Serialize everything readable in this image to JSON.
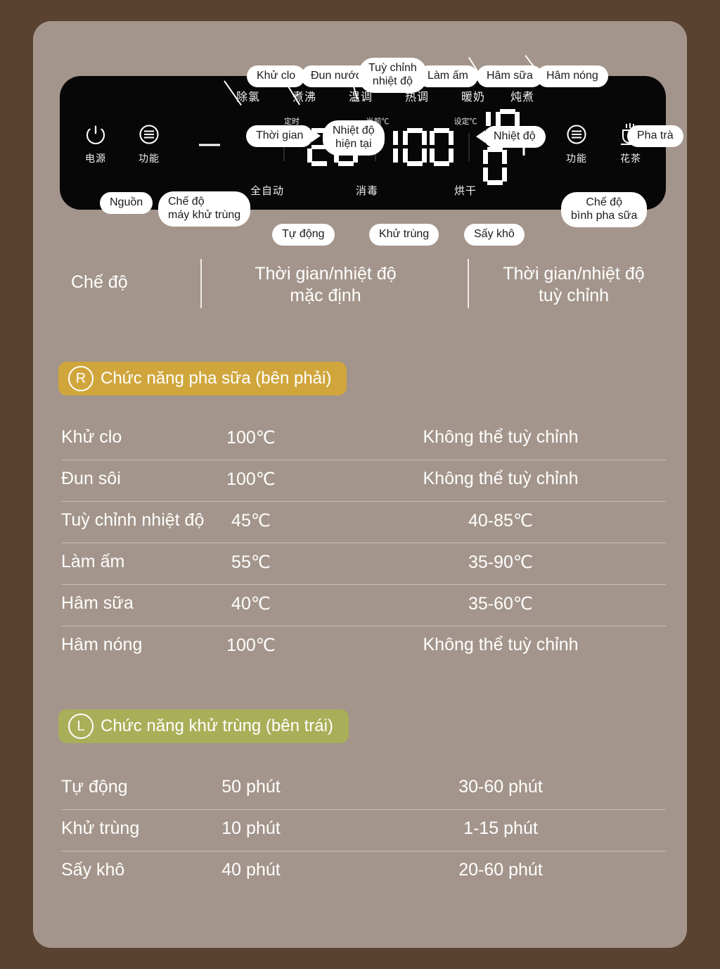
{
  "theme": {
    "outer_bg": "#5a4230",
    "card_bg": "#a3958b",
    "panel_bg": "#070707",
    "banner_right": "#d0a63c",
    "banner_left": "#a9af58",
    "text": "#ffffff"
  },
  "panel": {
    "mode_labels_cn": [
      {
        "text": "除氯"
      },
      {
        "text": "煮沸"
      },
      {
        "text": "温调"
      },
      {
        "text": "热调"
      },
      {
        "text": "暖奶"
      },
      {
        "text": "炖煮"
      }
    ],
    "bottom_labels_cn": [
      {
        "text": "全自动"
      },
      {
        "text": "消毒"
      },
      {
        "text": "烘干"
      }
    ],
    "tiny_labels_cn": [
      {
        "text": "定时"
      },
      {
        "text": "当前℃"
      },
      {
        "text": "设定℃"
      }
    ],
    "power_button": {
      "cn": "电源",
      "icon": "power-icon"
    },
    "function_button_left": {
      "cn": "功能",
      "icon": "menu-icon"
    },
    "function_button_right": {
      "cn": "功能",
      "icon": "menu-icon"
    },
    "tea_button": {
      "cn": "花茶",
      "icon": "teacup-icon"
    },
    "minus_label": "−",
    "plus_label": "+",
    "display": {
      "timer": "20",
      "current_temp": "100",
      "set_temp": "100"
    }
  },
  "callouts": {
    "khu_clo": "Khử clo",
    "dun_nuoc": "Đun nước",
    "tuy_chinh_nhiet_do": "Tuỳ chỉnh\nnhiệt độ",
    "lam_am": "Làm ấm",
    "ham_sua": "Hâm sữa",
    "ham_nong": "Hâm nóng",
    "thoi_gian": "Thời gian",
    "nhiet_do_hien_tai": "Nhiệt độ\nhiện tại",
    "nhiet_do": "Nhiệt độ",
    "pha_tra": "Pha trà",
    "nguon": "Nguồn",
    "che_do_may_khu_trung": "Chế độ\nmáy khử trùng",
    "che_do_binh_pha_sua": "Chế độ\nbình pha sữa",
    "tu_dong": "Tự động",
    "khu_trung": "Khử trùng",
    "say_kho": "Sấy khô"
  },
  "table": {
    "headers": {
      "mode": "Chế độ",
      "default": "Thời gian/nhiệt độ\nmặc định",
      "custom": "Thời gian/nhiệt độ\ntuỳ chỉnh"
    },
    "sections": [
      {
        "badge": "R",
        "title": "Chức năng pha sữa (bên phải)",
        "color": "#d0a63c",
        "rows": [
          {
            "mode": "Khử clo",
            "default": "100℃",
            "custom": "Không thể tuỳ chỉnh"
          },
          {
            "mode": "Đun sôi",
            "default": "100℃",
            "custom": "Không thể tuỳ chỉnh"
          },
          {
            "mode": "Tuỳ chỉnh nhiệt độ",
            "default": "45℃",
            "custom": "40-85℃"
          },
          {
            "mode": "Làm ấm",
            "default": "55℃",
            "custom": "35-90℃"
          },
          {
            "mode": "Hâm sữa",
            "default": "40℃",
            "custom": "35-60℃"
          },
          {
            "mode": "Hâm nóng",
            "default": "100℃",
            "custom": "Không thể tuỳ chỉnh"
          }
        ]
      },
      {
        "badge": "L",
        "title": "Chức năng khử trùng (bên trái)",
        "color": "#a9af58",
        "rows": [
          {
            "mode": "Tự động",
            "default": "50 phút",
            "custom": "30-60 phút"
          },
          {
            "mode": "Khử trùng",
            "default": "10 phút",
            "custom": "1-15 phút"
          },
          {
            "mode": "Sấy khô",
            "default": "40 phút",
            "custom": "20-60 phút"
          }
        ]
      }
    ]
  }
}
